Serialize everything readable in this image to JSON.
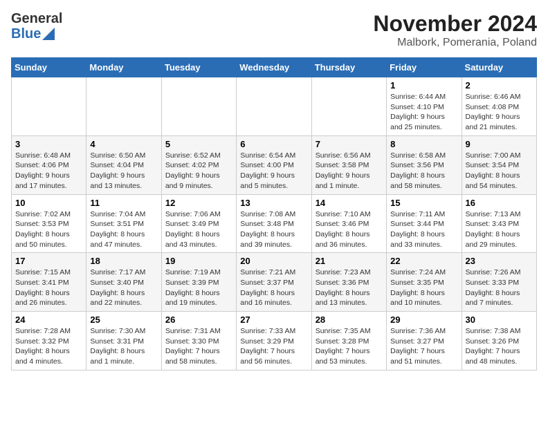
{
  "logo": {
    "general": "General",
    "blue": "Blue"
  },
  "title": "November 2024",
  "subtitle": "Malbork, Pomerania, Poland",
  "days_of_week": [
    "Sunday",
    "Monday",
    "Tuesday",
    "Wednesday",
    "Thursday",
    "Friday",
    "Saturday"
  ],
  "weeks": [
    [
      {
        "day": "",
        "detail": ""
      },
      {
        "day": "",
        "detail": ""
      },
      {
        "day": "",
        "detail": ""
      },
      {
        "day": "",
        "detail": ""
      },
      {
        "day": "",
        "detail": ""
      },
      {
        "day": "1",
        "detail": "Sunrise: 6:44 AM\nSunset: 4:10 PM\nDaylight: 9 hours\nand 25 minutes."
      },
      {
        "day": "2",
        "detail": "Sunrise: 6:46 AM\nSunset: 4:08 PM\nDaylight: 9 hours\nand 21 minutes."
      }
    ],
    [
      {
        "day": "3",
        "detail": "Sunrise: 6:48 AM\nSunset: 4:06 PM\nDaylight: 9 hours\nand 17 minutes."
      },
      {
        "day": "4",
        "detail": "Sunrise: 6:50 AM\nSunset: 4:04 PM\nDaylight: 9 hours\nand 13 minutes."
      },
      {
        "day": "5",
        "detail": "Sunrise: 6:52 AM\nSunset: 4:02 PM\nDaylight: 9 hours\nand 9 minutes."
      },
      {
        "day": "6",
        "detail": "Sunrise: 6:54 AM\nSunset: 4:00 PM\nDaylight: 9 hours\nand 5 minutes."
      },
      {
        "day": "7",
        "detail": "Sunrise: 6:56 AM\nSunset: 3:58 PM\nDaylight: 9 hours\nand 1 minute."
      },
      {
        "day": "8",
        "detail": "Sunrise: 6:58 AM\nSunset: 3:56 PM\nDaylight: 8 hours\nand 58 minutes."
      },
      {
        "day": "9",
        "detail": "Sunrise: 7:00 AM\nSunset: 3:54 PM\nDaylight: 8 hours\nand 54 minutes."
      }
    ],
    [
      {
        "day": "10",
        "detail": "Sunrise: 7:02 AM\nSunset: 3:53 PM\nDaylight: 8 hours\nand 50 minutes."
      },
      {
        "day": "11",
        "detail": "Sunrise: 7:04 AM\nSunset: 3:51 PM\nDaylight: 8 hours\nand 47 minutes."
      },
      {
        "day": "12",
        "detail": "Sunrise: 7:06 AM\nSunset: 3:49 PM\nDaylight: 8 hours\nand 43 minutes."
      },
      {
        "day": "13",
        "detail": "Sunrise: 7:08 AM\nSunset: 3:48 PM\nDaylight: 8 hours\nand 39 minutes."
      },
      {
        "day": "14",
        "detail": "Sunrise: 7:10 AM\nSunset: 3:46 PM\nDaylight: 8 hours\nand 36 minutes."
      },
      {
        "day": "15",
        "detail": "Sunrise: 7:11 AM\nSunset: 3:44 PM\nDaylight: 8 hours\nand 33 minutes."
      },
      {
        "day": "16",
        "detail": "Sunrise: 7:13 AM\nSunset: 3:43 PM\nDaylight: 8 hours\nand 29 minutes."
      }
    ],
    [
      {
        "day": "17",
        "detail": "Sunrise: 7:15 AM\nSunset: 3:41 PM\nDaylight: 8 hours\nand 26 minutes."
      },
      {
        "day": "18",
        "detail": "Sunrise: 7:17 AM\nSunset: 3:40 PM\nDaylight: 8 hours\nand 22 minutes."
      },
      {
        "day": "19",
        "detail": "Sunrise: 7:19 AM\nSunset: 3:39 PM\nDaylight: 8 hours\nand 19 minutes."
      },
      {
        "day": "20",
        "detail": "Sunrise: 7:21 AM\nSunset: 3:37 PM\nDaylight: 8 hours\nand 16 minutes."
      },
      {
        "day": "21",
        "detail": "Sunrise: 7:23 AM\nSunset: 3:36 PM\nDaylight: 8 hours\nand 13 minutes."
      },
      {
        "day": "22",
        "detail": "Sunrise: 7:24 AM\nSunset: 3:35 PM\nDaylight: 8 hours\nand 10 minutes."
      },
      {
        "day": "23",
        "detail": "Sunrise: 7:26 AM\nSunset: 3:33 PM\nDaylight: 8 hours\nand 7 minutes."
      }
    ],
    [
      {
        "day": "24",
        "detail": "Sunrise: 7:28 AM\nSunset: 3:32 PM\nDaylight: 8 hours\nand 4 minutes."
      },
      {
        "day": "25",
        "detail": "Sunrise: 7:30 AM\nSunset: 3:31 PM\nDaylight: 8 hours\nand 1 minute."
      },
      {
        "day": "26",
        "detail": "Sunrise: 7:31 AM\nSunset: 3:30 PM\nDaylight: 7 hours\nand 58 minutes."
      },
      {
        "day": "27",
        "detail": "Sunrise: 7:33 AM\nSunset: 3:29 PM\nDaylight: 7 hours\nand 56 minutes."
      },
      {
        "day": "28",
        "detail": "Sunrise: 7:35 AM\nSunset: 3:28 PM\nDaylight: 7 hours\nand 53 minutes."
      },
      {
        "day": "29",
        "detail": "Sunrise: 7:36 AM\nSunset: 3:27 PM\nDaylight: 7 hours\nand 51 minutes."
      },
      {
        "day": "30",
        "detail": "Sunrise: 7:38 AM\nSunset: 3:26 PM\nDaylight: 7 hours\nand 48 minutes."
      }
    ]
  ]
}
